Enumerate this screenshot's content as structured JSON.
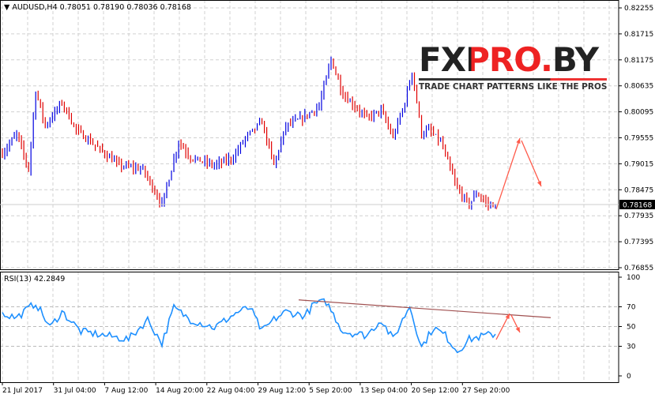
{
  "chart_data": {
    "type": "ohlc-bar",
    "symbol_header": "AUDUSD,H4",
    "ohlc_last": [
      "0.78051",
      "0.78190",
      "0.78036",
      "0.78168"
    ],
    "current_price": "0.78168",
    "y_ticks": [
      "0.82255",
      "0.81715",
      "0.81175",
      "0.80635",
      "0.80095",
      "0.79555",
      "0.79015",
      "0.78475",
      "0.77935",
      "0.77395",
      "0.76855"
    ],
    "ylim": [
      0.76855,
      0.82255
    ],
    "x_ticks": [
      "21 Jul 2017",
      "31 Jul 04:00",
      "7 Aug 12:00",
      "14 Aug 20:00",
      "22 Aug 04:00",
      "29 Aug 12:00",
      "5 Sep 20:00",
      "13 Sep 04:00",
      "20 Sep 12:00",
      "27 Sep 20:00"
    ],
    "bars_count": 208,
    "close_keypoints": [
      [
        0,
        0.79228
      ],
      [
        6,
        0.79637
      ],
      [
        11,
        0.78901
      ],
      [
        14,
        0.80537
      ],
      [
        18,
        0.798
      ],
      [
        25,
        0.80291
      ],
      [
        31,
        0.79718
      ],
      [
        39,
        0.79391
      ],
      [
        49,
        0.78982
      ],
      [
        59,
        0.78901
      ],
      [
        67,
        0.78164
      ],
      [
        74,
        0.79473
      ],
      [
        79,
        0.79146
      ],
      [
        89,
        0.78982
      ],
      [
        97,
        0.79146
      ],
      [
        102,
        0.79555
      ],
      [
        109,
        0.79882
      ],
      [
        114,
        0.78982
      ],
      [
        119,
        0.798
      ],
      [
        126,
        0.79964
      ],
      [
        133,
        0.80209
      ],
      [
        138,
        0.81191
      ],
      [
        143,
        0.80455
      ],
      [
        153,
        0.79964
      ],
      [
        159,
        0.80127
      ],
      [
        164,
        0.79555
      ],
      [
        169,
        0.80291
      ],
      [
        172,
        0.80946
      ],
      [
        176,
        0.79637
      ],
      [
        179,
        0.79718
      ],
      [
        184,
        0.79473
      ],
      [
        191,
        0.78491
      ],
      [
        196,
        0.78164
      ],
      [
        199,
        0.7841
      ],
      [
        204,
        0.78164
      ],
      [
        207,
        0.78168
      ]
    ],
    "bull_color": "#0000e0",
    "bear_color": "#e00000",
    "rsi": {
      "label": "RSI(13)",
      "value": "42.2849",
      "y_ticks": [
        "100",
        "70",
        "50",
        "30",
        "0"
      ],
      "line_color": "#1e90ff",
      "keypoints": [
        [
          0,
          63
        ],
        [
          6,
          59
        ],
        [
          14,
          74
        ],
        [
          20,
          49
        ],
        [
          25,
          65
        ],
        [
          33,
          45
        ],
        [
          43,
          41
        ],
        [
          53,
          37
        ],
        [
          61,
          57
        ],
        [
          67,
          33
        ],
        [
          72,
          69
        ],
        [
          79,
          57
        ],
        [
          89,
          49
        ],
        [
          99,
          65
        ],
        [
          104,
          69
        ],
        [
          109,
          45
        ],
        [
          114,
          57
        ],
        [
          119,
          65
        ],
        [
          127,
          61
        ],
        [
          131,
          73
        ],
        [
          136,
          75
        ],
        [
          143,
          45
        ],
        [
          153,
          41
        ],
        [
          159,
          57
        ],
        [
          164,
          37
        ],
        [
          171,
          71
        ],
        [
          176,
          29
        ],
        [
          181,
          49
        ],
        [
          186,
          41
        ],
        [
          191,
          25
        ],
        [
          196,
          37
        ],
        [
          203,
          41
        ],
        [
          207,
          42.28
        ]
      ],
      "trendline": {
        "color": "#a05050",
        "from": [
          125,
          77
        ],
        "to": [
          232,
          59
        ]
      }
    },
    "forecast_arrows_color": "#ff5a4a",
    "watermark": {
      "brand": "FXPRO.BY",
      "tagline": "TRADE CHART PATTERNS LIKE THE PROS"
    }
  }
}
